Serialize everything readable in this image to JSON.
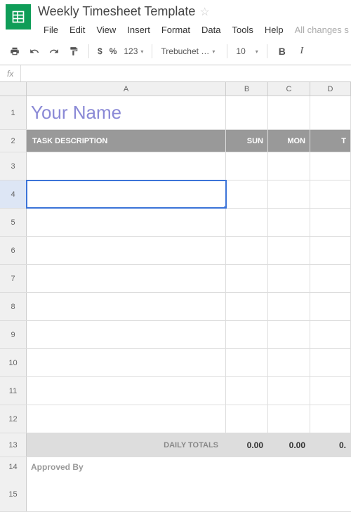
{
  "doc": {
    "title": "Weekly Timesheet Template"
  },
  "menubar": [
    "File",
    "Edit",
    "View",
    "Insert",
    "Format",
    "Data",
    "Tools",
    "Help"
  ],
  "save_status": "All changes s",
  "toolbar": {
    "currency": "$",
    "percent": "%",
    "num123": "123",
    "font": "Trebuchet …",
    "size": "10",
    "bold": "B",
    "italic": "I"
  },
  "fx": {
    "label": "fx"
  },
  "columns": [
    "A",
    "B",
    "C",
    "D"
  ],
  "rows": [
    "1",
    "2",
    "3",
    "4",
    "5",
    "6",
    "7",
    "8",
    "9",
    "10",
    "11",
    "12",
    "13",
    "14",
    "15"
  ],
  "sheet": {
    "name_title": "Your Name",
    "task_header": "TASK DESCRIPTION",
    "days": {
      "sun": "SUN",
      "mon": "MON",
      "tue": "T"
    },
    "daily_totals_label": "DAILY TOTALS",
    "totals": {
      "sun": "0.00",
      "mon": "0.00",
      "tue": "0."
    },
    "approved_by": "Approved By"
  },
  "selection": {
    "row": "4",
    "col": "A"
  }
}
